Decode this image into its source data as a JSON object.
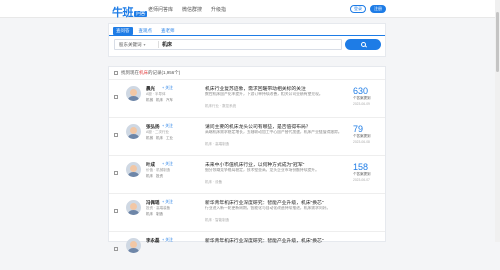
{
  "header": {
    "logo_text": "牛班",
    "logo_badge": "问答",
    "nav": [
      "老师问答库",
      "微信群搜",
      "升级指"
    ],
    "login_label": "登录",
    "register_label": "注册"
  },
  "search": {
    "tabs": [
      {
        "label": "查问答",
        "active": true
      },
      {
        "label": "查观点",
        "active": false
      },
      {
        "label": "查老师",
        "active": false
      }
    ],
    "scope_label": "股东关键词",
    "query": "机床"
  },
  "results_header": {
    "prefix": "找到现在",
    "keyword": "机床",
    "suffix": "的记录(1,956个)"
  },
  "results": [
    {
      "name": "晨光",
      "follow": "+ 关注",
      "meta": "A股 · 半导体",
      "tags": [
        "机械",
        "机床",
        "汽车"
      ],
      "title": "机床行业复苏迹象，需求回暖带动相关标的关注",
      "desc": "数控机床国产化率提升，下游订单持续改善，相关公司业绩有望兑现。",
      "foot": "机床行业 · 数控系统",
      "count": "630",
      "count_label": "个答案提到",
      "date": "2023-06-09"
    },
    {
      "name": "张弘扬",
      "follow": "+ 关注",
      "meta": "A股 · 二次行业",
      "tags": [
        "机械",
        "机床",
        "工业"
      ],
      "title": "请问主要的机床龙头公司有哪些，是否值得布局？",
      "desc": "高端机床需求稳定增长，五轴联动加工中心国产替代加速，机床产业链值得跟踪。",
      "foot": "机床 · 高端制造",
      "count": "79",
      "count_label": "个答案提到",
      "date": "2023-06-08"
    },
    {
      "name": "叶成",
      "follow": "+ 关注",
      "meta": "价值 · 机械制造",
      "tags": [
        "机床",
        "投资"
      ],
      "title": "未来中小市值机床行业，以何种方式成为\"冠军\"",
      "desc": "细分领域竞争格局稳定，技术壁垒高，龙头企业市场份额持续提升。",
      "foot": "机床 · 设备",
      "count": "158",
      "count_label": "个答案提到",
      "date": "2023-06-07"
    },
    {
      "name": "冯佩瑶",
      "follow": "+ 关注",
      "meta": "投资 · 高端装备",
      "tags": [
        "机床",
        "制造"
      ],
      "title": "新华青年机床行业深度研究：智能产业升级，机床\"换芯\"",
      "desc": "行业进入新一轮更新周期，智能化与自动化改造持续推进，机床需求向好。",
      "foot": "机床 · 智能制造",
      "count": "",
      "count_label": "",
      "date": ""
    },
    {
      "name": "李永磊",
      "follow": "+ 关注",
      "meta": "投资 · 行业研究",
      "tags": [
        "机床"
      ],
      "title": "新华青年机床行业深度研究：智能产业升级，机床\"换芯\"",
      "desc": "",
      "foot": "",
      "count": "",
      "count_label": "",
      "date": ""
    }
  ]
}
